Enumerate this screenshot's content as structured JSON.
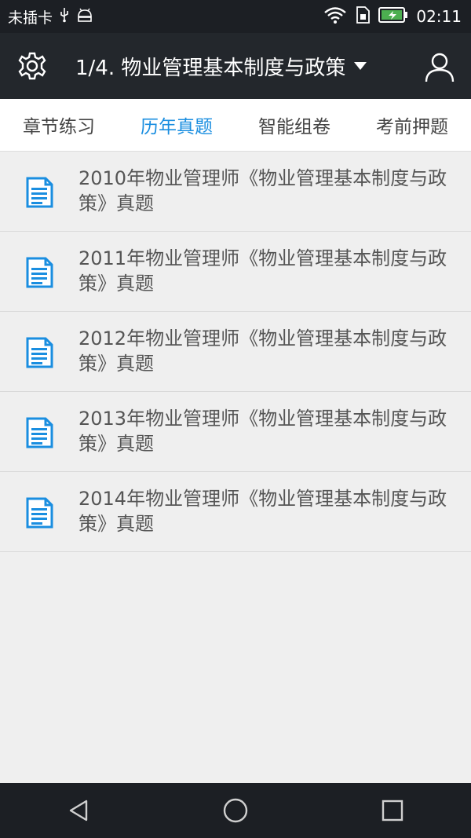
{
  "status_bar": {
    "carrier": "未插卡",
    "time": "02:11"
  },
  "app_bar": {
    "title": "1/4. 物业管理基本制度与政策"
  },
  "tabs": [
    {
      "label": "章节练习",
      "active": false
    },
    {
      "label": "历年真题",
      "active": true
    },
    {
      "label": "智能组卷",
      "active": false
    },
    {
      "label": "考前押题",
      "active": false
    }
  ],
  "exams": [
    {
      "title": "2010年物业管理师《物业管理基本制度与政策》真题"
    },
    {
      "title": "2011年物业管理师《物业管理基本制度与政策》真题"
    },
    {
      "title": "2012年物业管理师《物业管理基本制度与政策》真题"
    },
    {
      "title": "2013年物业管理师《物业管理基本制度与政策》真题"
    },
    {
      "title": "2014年物业管理师《物业管理基本制度与政策》真题"
    }
  ],
  "colors": {
    "accent": "#1a8ee0",
    "app_bar": "#23272c",
    "status_bar": "#1c1f24",
    "background": "#efefef"
  }
}
